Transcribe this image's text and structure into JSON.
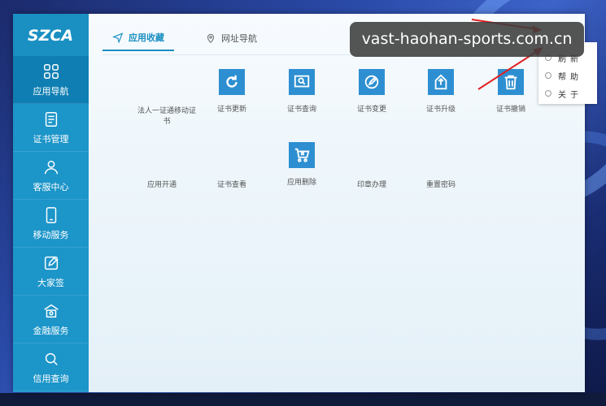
{
  "sidebar": {
    "logo_text": "SZCA",
    "items": [
      {
        "label": "应用导航",
        "icon": "grid-icon"
      },
      {
        "label": "证书管理",
        "icon": "document-icon"
      },
      {
        "label": "客服中心",
        "icon": "user-icon"
      },
      {
        "label": "移动服务",
        "icon": "mobile-icon"
      },
      {
        "label": "大家签",
        "icon": "edit-icon"
      },
      {
        "label": "金融服务",
        "icon": "bank-icon"
      },
      {
        "label": "信用查询",
        "icon": "search-icon"
      }
    ]
  },
  "tabs": [
    {
      "label": "应用收藏",
      "icon": "send-icon"
    },
    {
      "label": "网址导航",
      "icon": "location-icon"
    }
  ],
  "apps": [
    {
      "label": "法人一证通移动证书",
      "icon": "none"
    },
    {
      "label": "证书更新",
      "icon": "refresh-icon"
    },
    {
      "label": "证书查询",
      "icon": "search-doc-icon"
    },
    {
      "label": "证书变更",
      "icon": "pen-icon"
    },
    {
      "label": "证书升级",
      "icon": "upgrade-icon"
    },
    {
      "label": "证书撤销",
      "icon": "trash-icon"
    },
    {
      "label": "应用开通",
      "icon": "none"
    },
    {
      "label": "证书查看",
      "icon": "none"
    },
    {
      "label": "应用删除",
      "icon": "cart-delete-icon"
    },
    {
      "label": "印章办理",
      "icon": "none"
    },
    {
      "label": "重置密码",
      "icon": "none"
    }
  ],
  "context_menu": {
    "items": [
      "刷新",
      "帮助",
      "关于"
    ]
  },
  "watermark": "vast-haohan-sports.com.cn",
  "colors": {
    "sidebar": "#1c95c9",
    "sidebar_active": "#0f7fb3",
    "accent": "#1a8fc2",
    "app_icon": "#2d8fd1"
  }
}
